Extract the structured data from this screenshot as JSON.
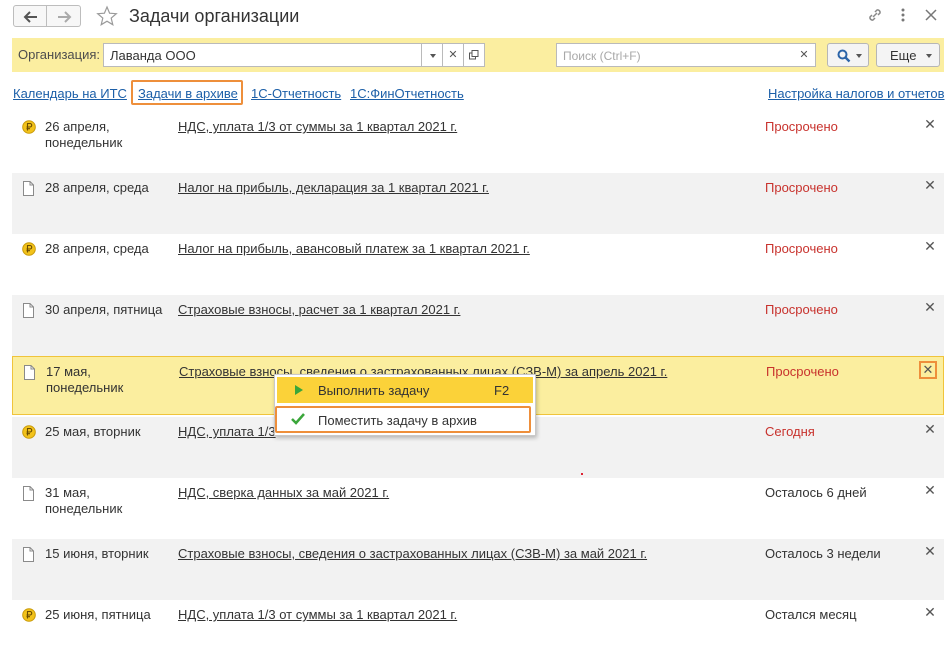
{
  "window": {
    "title": "Задачи организации"
  },
  "filter": {
    "org_label": "Организация:",
    "org_value": "Лаванда ООО",
    "search_placeholder": "Поиск (Ctrl+F)",
    "more_label": "Еще"
  },
  "links": {
    "calendar": "Календарь на ИТС",
    "archive": "Задачи в архиве",
    "reporting": "1С-Отчетность",
    "fin_reporting": "1С:ФинОтчетность",
    "settings": "Настройка налогов и отчетов"
  },
  "tasks": [
    {
      "icon": "ruble-coin-icon",
      "date": "26 апреля, понедельник",
      "task": "НДС, уплата 1/3 от суммы за 1 квартал 2021 г.",
      "status": "Просрочено",
      "status_color": "#c8322d"
    },
    {
      "icon": "document-icon",
      "date": "28 апреля, среда",
      "task": "Налог на прибыль, декларация за 1 квартал 2021 г.",
      "status": "Просрочено",
      "status_color": "#c8322d"
    },
    {
      "icon": "ruble-coin-icon",
      "date": "28 апреля, среда",
      "task": "Налог на прибыль, авансовый платеж за 1 квартал 2021 г.",
      "status": "Просрочено",
      "status_color": "#c8322d"
    },
    {
      "icon": "document-icon",
      "date": "30 апреля, пятница",
      "task": "Страховые взносы, расчет за 1 квартал 2021 г.",
      "status": "Просрочено",
      "status_color": "#c8322d"
    },
    {
      "icon": "document-icon",
      "date": "17 мая, понедельник",
      "task": "Страховые взносы, сведения о застрахованных лицах (СЗВ-М) за апрель 2021 г.",
      "status": "Просрочено",
      "status_color": "#c8322d",
      "selected": true
    },
    {
      "icon": "ruble-coin-icon",
      "date": "25 мая, вторник",
      "task": "НДС, уплата 1/3",
      "status": "Сегодня",
      "status_color": "#c8322d"
    },
    {
      "icon": "document-icon",
      "date": "31 мая, понедельник",
      "task": "НДС, сверка данных за май 2021 г.",
      "status": "Осталось 6 дней",
      "status_color": "#333333"
    },
    {
      "icon": "document-icon",
      "date": "15 июня, вторник",
      "task": "Страховые взносы, сведения о застрахованных лицах (СЗВ-М) за май 2021 г.",
      "status": "Осталось 3 недели",
      "status_color": "#333333"
    },
    {
      "icon": "ruble-coin-icon",
      "date": "25 июня, пятница",
      "task": "НДС, уплата 1/3 от суммы за 1 квартал 2021 г.",
      "status": "Остался месяц",
      "status_color": "#333333"
    }
  ],
  "context_menu": {
    "execute_label": "Выполнить задачу",
    "execute_shortcut": "F2",
    "archive_label": "Поместить задачу в архив"
  },
  "colors": {
    "accent_yellow": "#fbd239",
    "highlight_orange": "#ee8f3b",
    "link_blue": "#1c5fa8",
    "overdue_red": "#c8322d"
  }
}
